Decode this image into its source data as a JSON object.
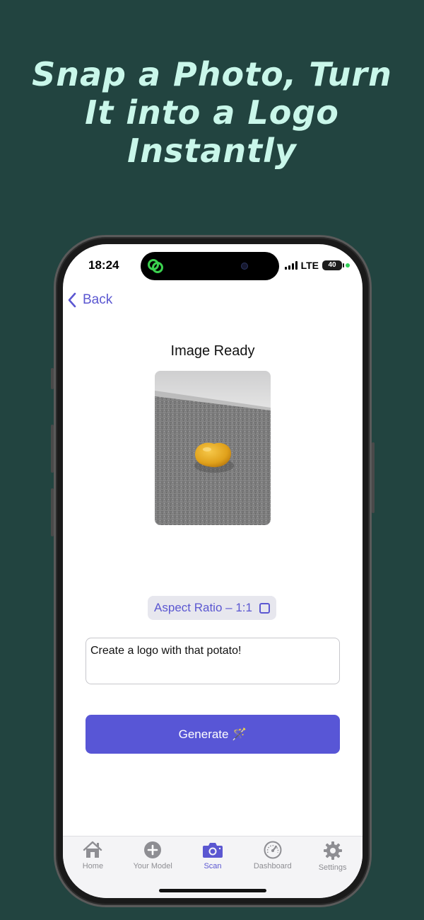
{
  "headline": [
    "Snap a Photo, Turn",
    "It into a Logo",
    "Instantly"
  ],
  "status_bar": {
    "time": "18:24",
    "network": "LTE",
    "battery": "40"
  },
  "nav": {
    "back_label": "Back"
  },
  "main": {
    "title": "Image Ready",
    "aspect_ratio_label": "Aspect Ratio – 1:1",
    "prompt_text": "Create a logo with that potato!",
    "generate_label": "Generate 🪄"
  },
  "tabbar": {
    "tabs": [
      {
        "label": "Home",
        "icon": "home-icon"
      },
      {
        "label": "Your Model",
        "icon": "plus-circle-icon"
      },
      {
        "label": "Scan",
        "icon": "camera-icon",
        "active": true
      },
      {
        "label": "Dashboard",
        "icon": "speedometer-icon"
      },
      {
        "label": "Settings",
        "icon": "gear-icon"
      }
    ]
  },
  "colors": {
    "accent": "#5856d6",
    "background": "#224440",
    "headline": "#c9f7ea"
  }
}
